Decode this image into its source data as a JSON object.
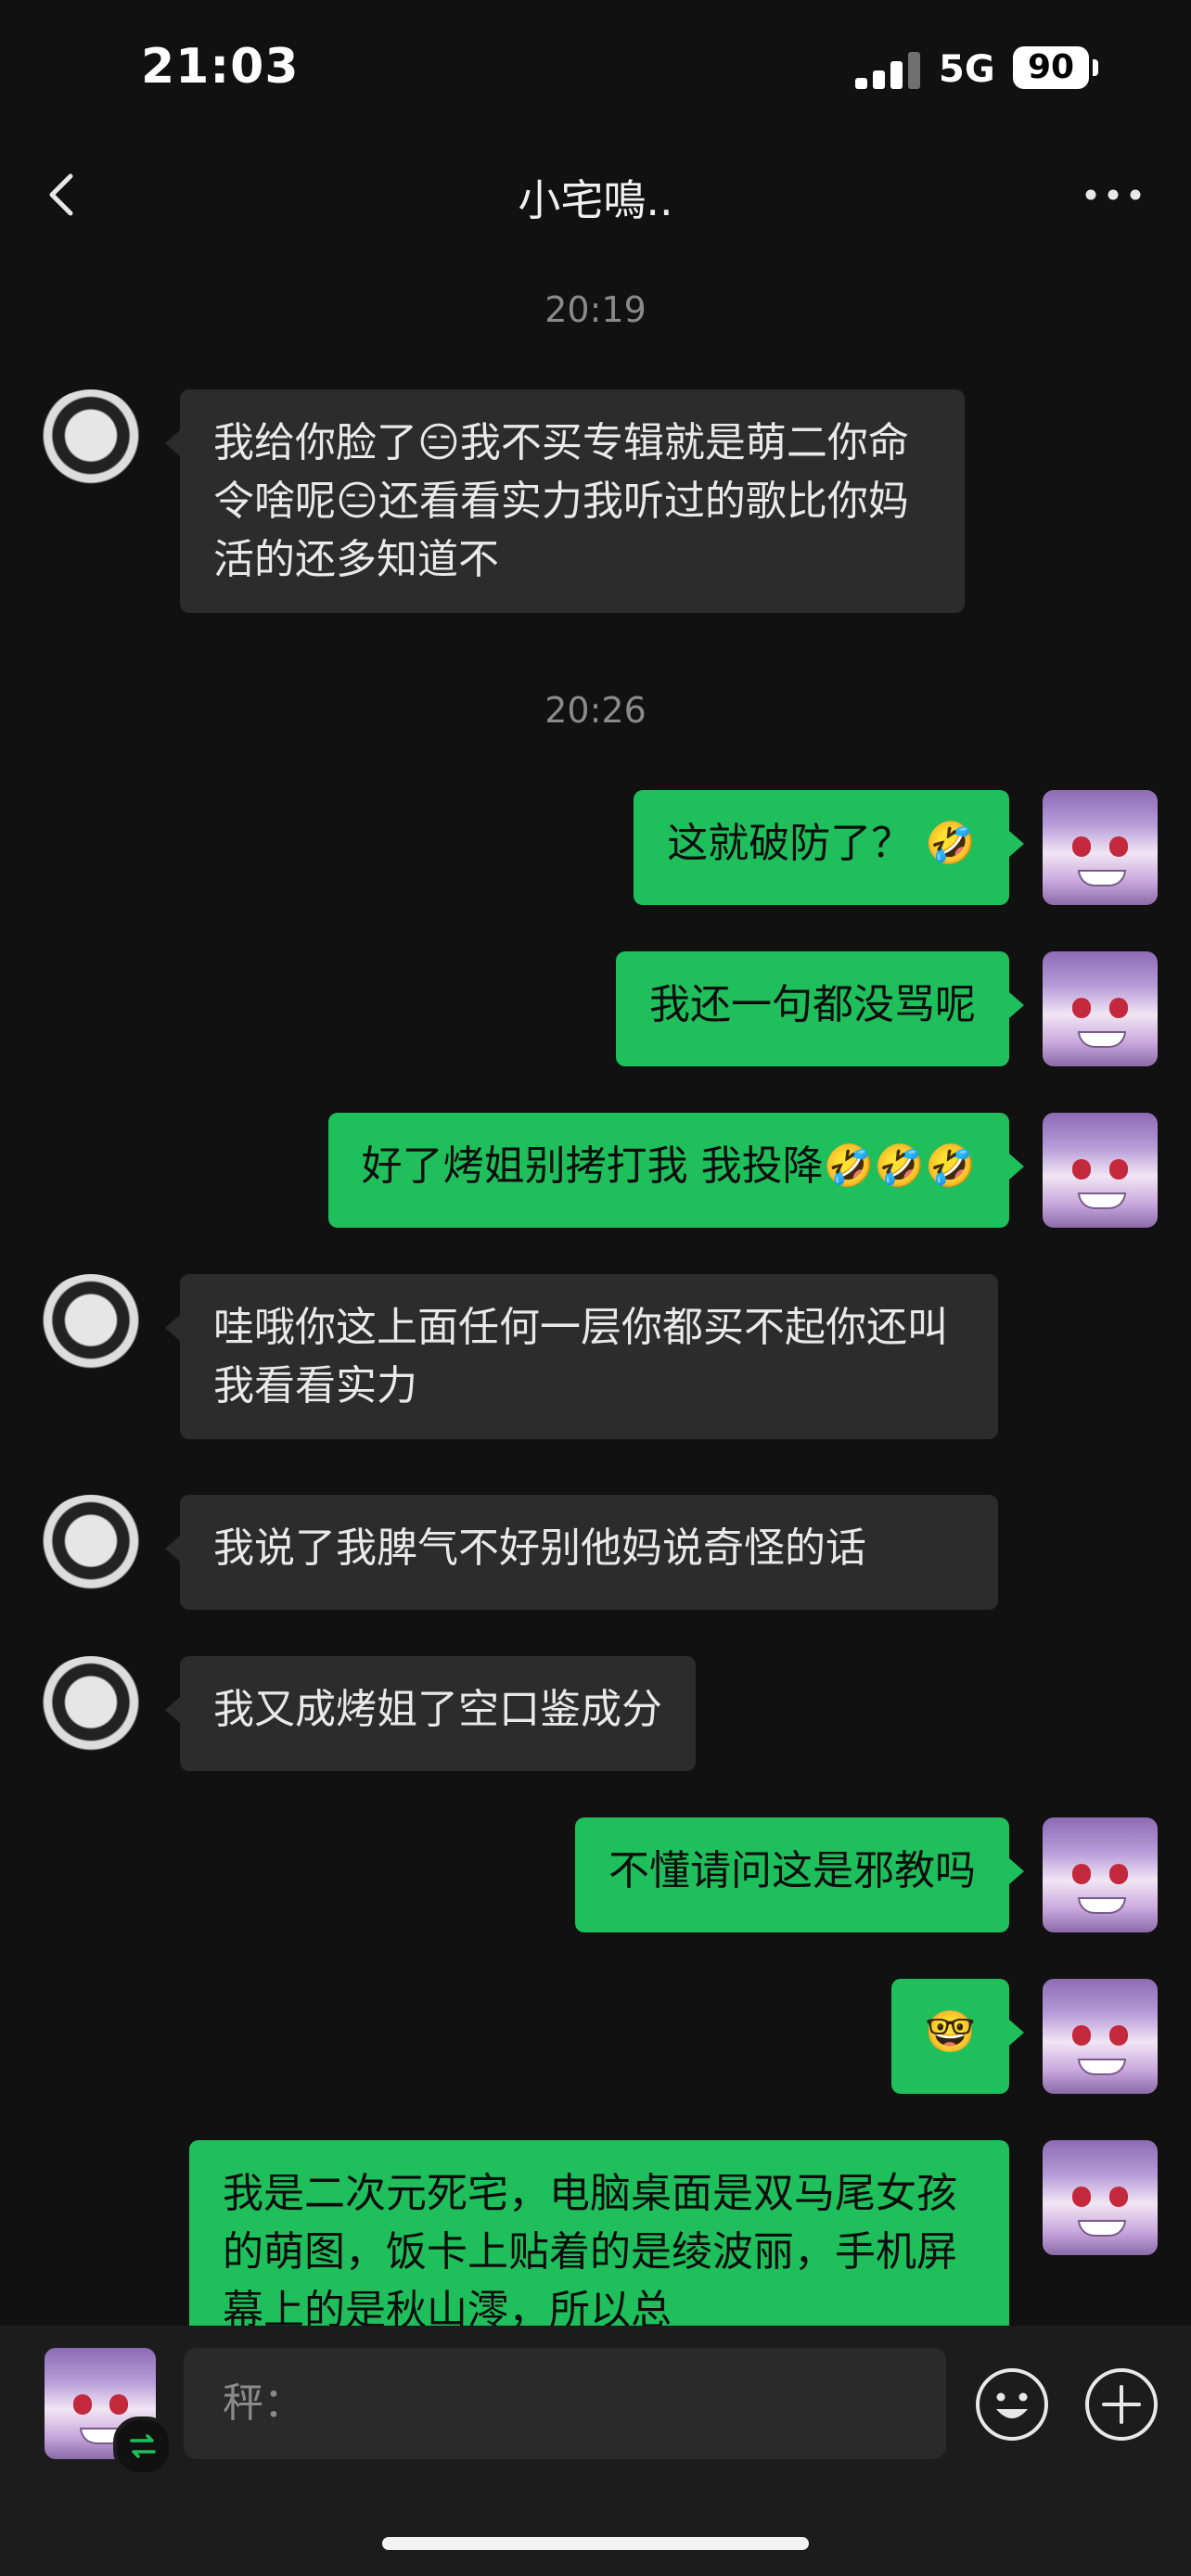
{
  "status_bar": {
    "time": "21:03",
    "network": "5G",
    "battery": "90"
  },
  "header": {
    "title": "小宅鳴.."
  },
  "messages": {
    "ts1": "20:19",
    "m1": "我给你脸了😑我不买专辑就是萌二你命令啥呢😑还看看实力我听过的歌比你妈活的还多知道不",
    "ts2": "20:26",
    "m2": "这就破防了？ 🤣",
    "m3": "我还一句都没骂呢",
    "m4": "好了烤姐别拷打我 我投降🤣🤣🤣",
    "m5": "哇哦你这上面任何一层你都买不起你还叫我看看实力",
    "m6": "我说了我脾气不好别他妈说奇怪的话",
    "m7": "我又成烤姐了空口鉴成分",
    "m8": "不懂请问这是邪教吗",
    "m9": "🤓",
    "m10": "我是二次元死宅，电脑桌面是双马尾女孩的萌图，饭卡上贴着的是绫波丽，手机屏幕上的是秋山澪，所以总"
  },
  "input": {
    "placeholder": "秤："
  },
  "icons": {
    "back": "chevron-left-icon",
    "more": "more-horizontal-icon",
    "emoji": "emoji-icon",
    "plus": "plus-circle-icon",
    "switch": "switch-icon"
  },
  "colors": {
    "outgoing": "#1fbf5c",
    "incoming": "#2c2c2c",
    "background": "#111111"
  }
}
